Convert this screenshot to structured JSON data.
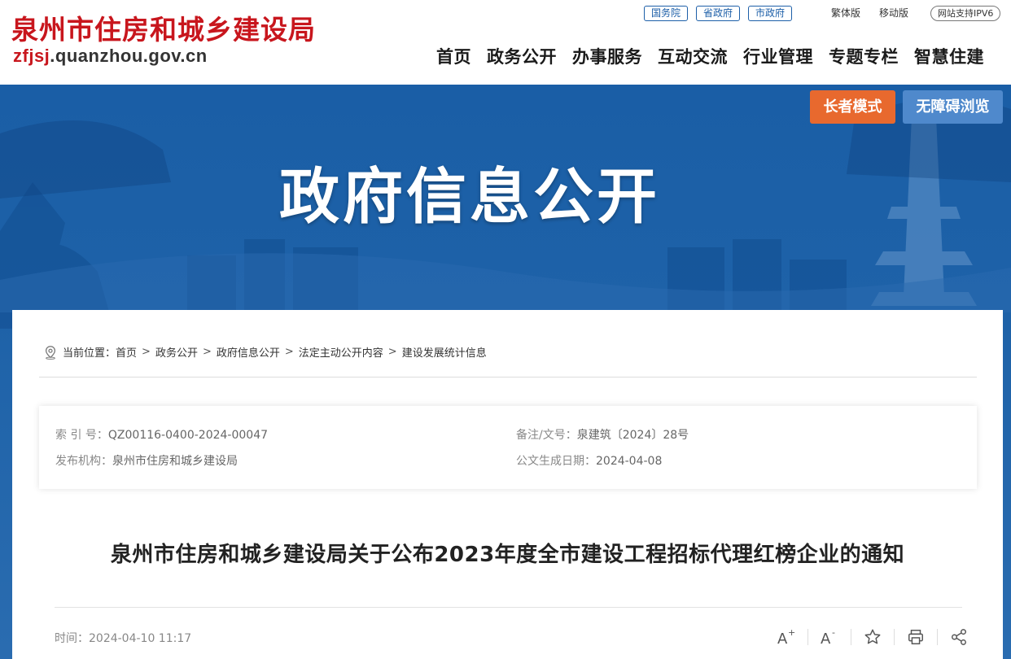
{
  "header": {
    "logo_title": "泉州市住房和城乡建设局",
    "logo_domain_hl": "zfjsj",
    "logo_domain_rest": ".quanzhou.gov.cn",
    "top_links": [
      "国务院",
      "省政府",
      "市政府"
    ],
    "traditional": "繁体版",
    "mobile": "移动版",
    "ipv6": "网站支持IPV6",
    "nav": [
      "首页",
      "政务公开",
      "办事服务",
      "互动交流",
      "行业管理",
      "专题专栏",
      "智慧住建"
    ]
  },
  "banner": {
    "title": "政府信息公开",
    "elder_mode": "长者模式",
    "accessible": "无障碍浏览"
  },
  "breadcrumb": {
    "prefix": "当前位置：",
    "items": [
      "首页",
      "政务公开",
      "政府信息公开",
      "法定主动公开内容",
      "建设发展统计信息"
    ]
  },
  "info": {
    "index_label": "索 引 号：",
    "index_value": "QZ00116-0400-2024-00047",
    "doc_label": "备注/文号：",
    "doc_value": "泉建筑〔2024〕28号",
    "org_label": "发布机构：",
    "org_value": "泉州市住房和城乡建设局",
    "date_label": "公文生成日期：",
    "date_value": "2024-04-08"
  },
  "document": {
    "title": "泉州市住房和城乡建设局关于公布2023年度全市建设工程招标代理红榜企业的通知",
    "time_label": "时间：",
    "time_value": "2024-04-10 11:17"
  },
  "tools": {
    "font_up_icon": "A+",
    "font_down_icon": "A-"
  }
}
